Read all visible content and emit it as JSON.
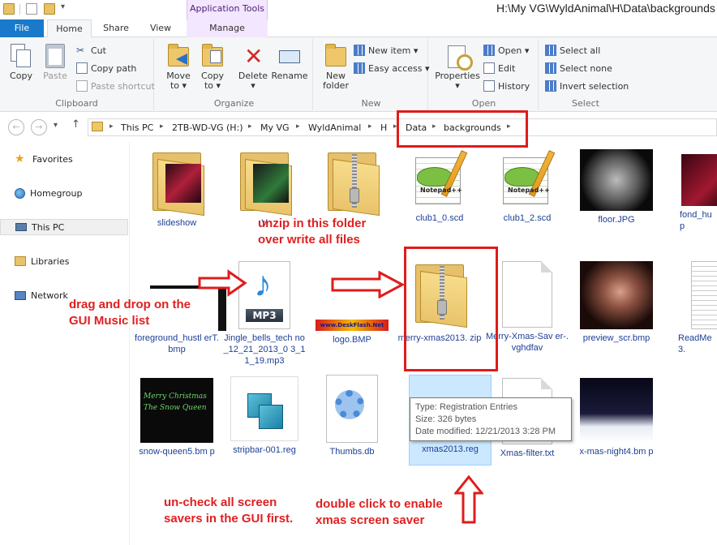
{
  "window": {
    "contextual_tab_title": "Application Tools",
    "title": "H:\\My VG\\WyldAnimal\\H\\Data\\backgrounds"
  },
  "tabs": [
    {
      "label": "File"
    },
    {
      "label": "Home"
    },
    {
      "label": "Share"
    },
    {
      "label": "View"
    },
    {
      "label": "Manage"
    }
  ],
  "ribbon": {
    "clipboard": {
      "label": "Clipboard",
      "copy": "Copy",
      "paste": "Paste",
      "cut": "Cut",
      "copy_path": "Copy path",
      "paste_shortcut": "Paste shortcut"
    },
    "organize": {
      "label": "Organize",
      "move_to_1": "Move",
      "move_to_2": "to ▾",
      "copy_to_1": "Copy",
      "copy_to_2": "to ▾",
      "delete_1": "Delete",
      "delete_2": "▾",
      "rename": "Rename"
    },
    "new": {
      "label": "New",
      "new_folder_1": "New",
      "new_folder_2": "folder",
      "new_item": "New item ▾",
      "easy_access": "Easy access ▾"
    },
    "open": {
      "label": "Open",
      "properties_1": "Properties",
      "properties_2": "▾",
      "open": "Open ▾",
      "edit": "Edit",
      "history": "History"
    },
    "select": {
      "label": "Select",
      "select_all": "Select all",
      "select_none": "Select none",
      "invert": "Invert selection"
    }
  },
  "address": {
    "crumbs": [
      "This PC",
      "2TB-WD-VG (H:)",
      "My VG",
      "WyldAnimal",
      "H",
      "Data",
      "backgrounds"
    ]
  },
  "sidebar": {
    "items": [
      {
        "label": "Favorites"
      },
      {
        "label": "Homegroup"
      },
      {
        "label": "This PC"
      },
      {
        "label": "Libraries"
      },
      {
        "label": "Network"
      }
    ]
  },
  "files": {
    "row1": [
      "slideshow",
      "V",
      "",
      "club1_0.scd",
      "club1_2.scd",
      "floor.JPG",
      "fond_hu p"
    ],
    "row2": [
      "foreground_hustl erT.bmp",
      "Jingle_bells_tech no_12_21_2013_0 3_11_19.mp3",
      "logo.BMP",
      "merry-xmas2013. zip",
      "Merry-Xmas-Sav er-.vghdfav",
      "preview_scr.bmp",
      "ReadMe 3."
    ],
    "row3": [
      "snow-queen5.bm p",
      "stripbar-001.reg",
      "Thumbs.db",
      "xmas2013.reg",
      "Xmas-filter.txt",
      "x-mas-night4.bm p"
    ]
  },
  "thumbnail_text": {
    "notepad": "Notepad++",
    "mp3_badge": "MP3",
    "logo_text": "www.DeskFlash.Net",
    "snow_queen": "Merry Christmas The Snow Queen"
  },
  "tooltip": {
    "type": "Type: Registration Entries",
    "size": "Size: 326 bytes",
    "modified": "Date modified: 12/21/2013 3:28 PM"
  },
  "annotations": {
    "unzip_1": "unzip in this folder",
    "unzip_2": "over write all files",
    "drag_1": "drag and drop on the",
    "drag_2": "GUI Music list",
    "uncheck_1": "un-check all screen",
    "uncheck_2": "savers in the GUI first.",
    "dblclick_1": "double click to enable",
    "dblclick_2": "xmas screen saver"
  },
  "colors": {
    "file_tab": "#1979ca",
    "annotation_red": "#e02020",
    "file_name": "#1c3f95",
    "selection": "#cce8ff"
  }
}
